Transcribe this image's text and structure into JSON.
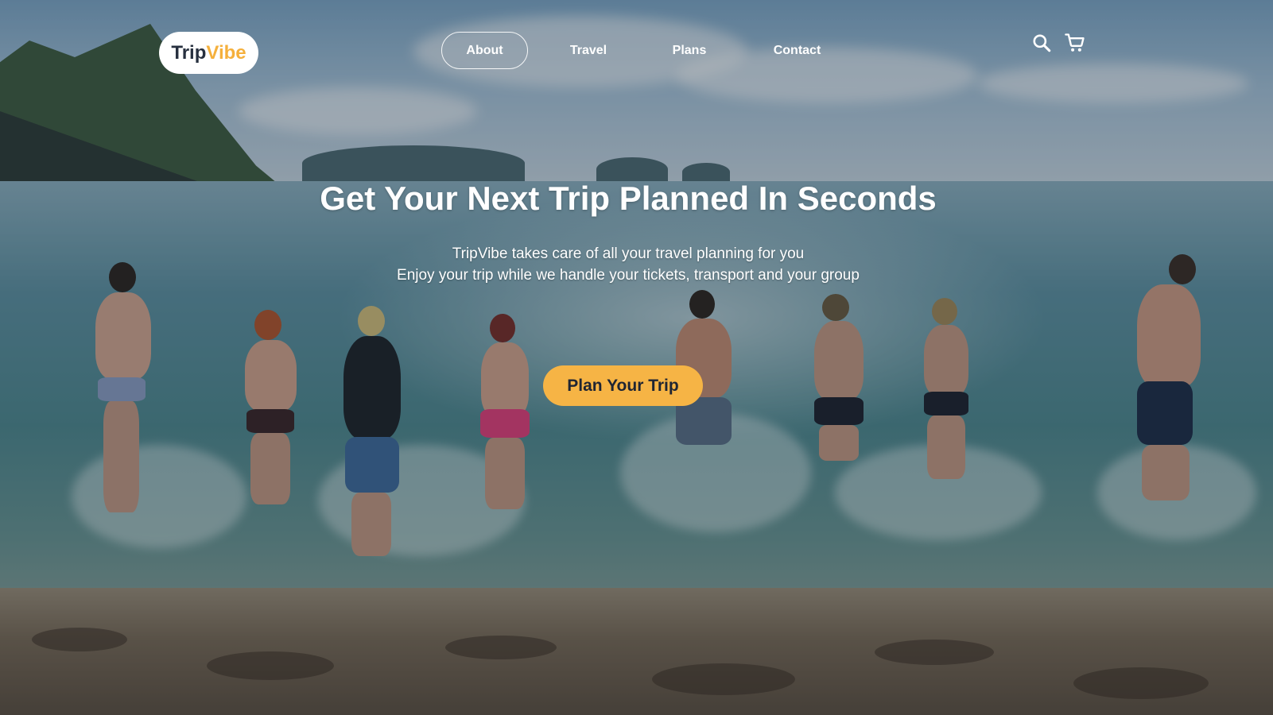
{
  "brand": {
    "part1": "Trip",
    "part2": "Vibe",
    "accent_color": "#f5b03c"
  },
  "nav": {
    "items": [
      {
        "label": "About",
        "active": true
      },
      {
        "label": "Travel",
        "active": false
      },
      {
        "label": "Plans",
        "active": false
      },
      {
        "label": "Contact",
        "active": false
      }
    ]
  },
  "header_icons": [
    "search-icon",
    "cart-icon"
  ],
  "hero": {
    "title": "Get Your Next Trip Planned In Seconds",
    "line1": "TripVibe takes care of all your travel planning for you",
    "line2": "Enjoy your trip while we handle your tickets, transport and your group",
    "cta_label": "Plan Your Trip",
    "cta_color": "#f6b445"
  }
}
